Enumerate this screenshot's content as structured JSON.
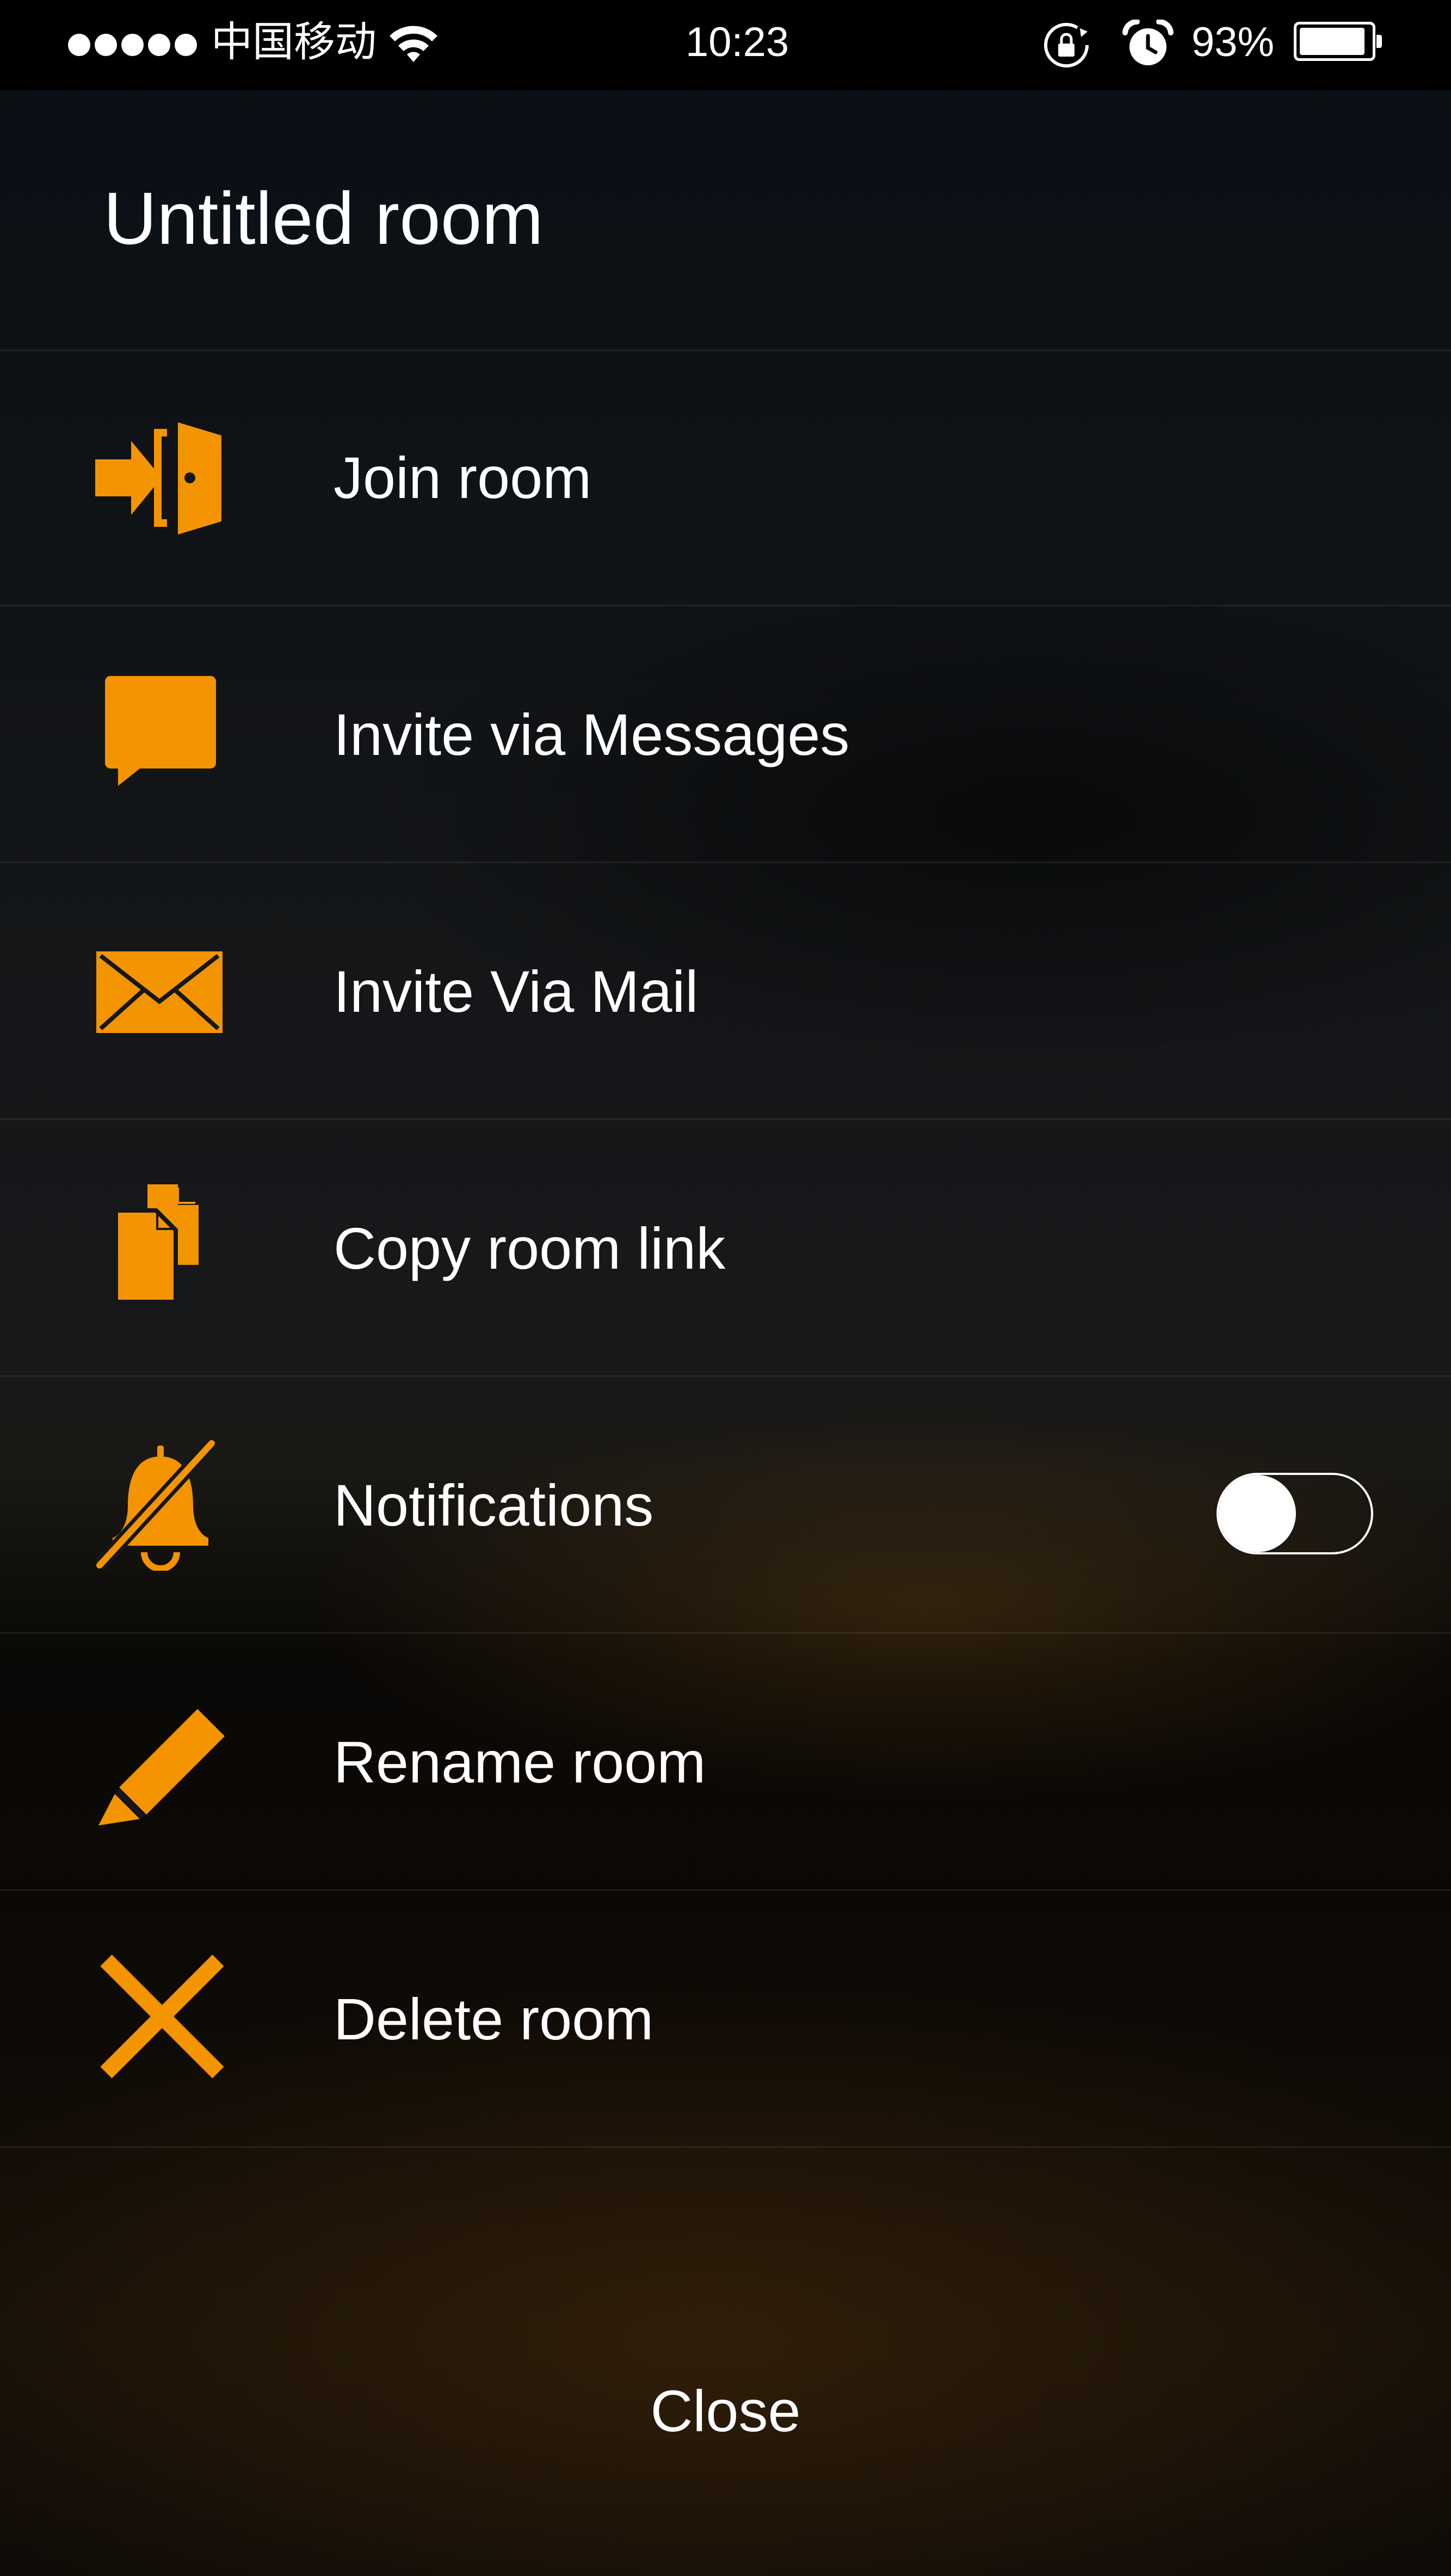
{
  "status_bar": {
    "carrier": "中国移动",
    "time": "10:23",
    "battery_percent": "93%",
    "battery_level": 0.93,
    "icons": [
      "signal-dots-icon",
      "wifi-icon",
      "rotation-lock-icon",
      "alarm-icon",
      "battery-icon"
    ]
  },
  "header": {
    "title": "Untitled room"
  },
  "menu": {
    "items": [
      {
        "label": "Join room",
        "icon": "enter-door-icon"
      },
      {
        "label": "Invite via Messages",
        "icon": "message-bubble-icon"
      },
      {
        "label": "Invite Via Mail",
        "icon": "mail-envelope-icon"
      },
      {
        "label": "Copy room link",
        "icon": "copy-documents-icon"
      },
      {
        "label": "Notifications",
        "icon": "bell-off-icon",
        "toggle_on": false
      },
      {
        "label": "Rename room",
        "icon": "pencil-icon"
      },
      {
        "label": "Delete room",
        "icon": "close-x-icon"
      }
    ]
  },
  "footer": {
    "close_label": "Close"
  },
  "colors": {
    "accent": "#f39400",
    "text": "#ffffff",
    "status_bar_bg": "#000000"
  }
}
